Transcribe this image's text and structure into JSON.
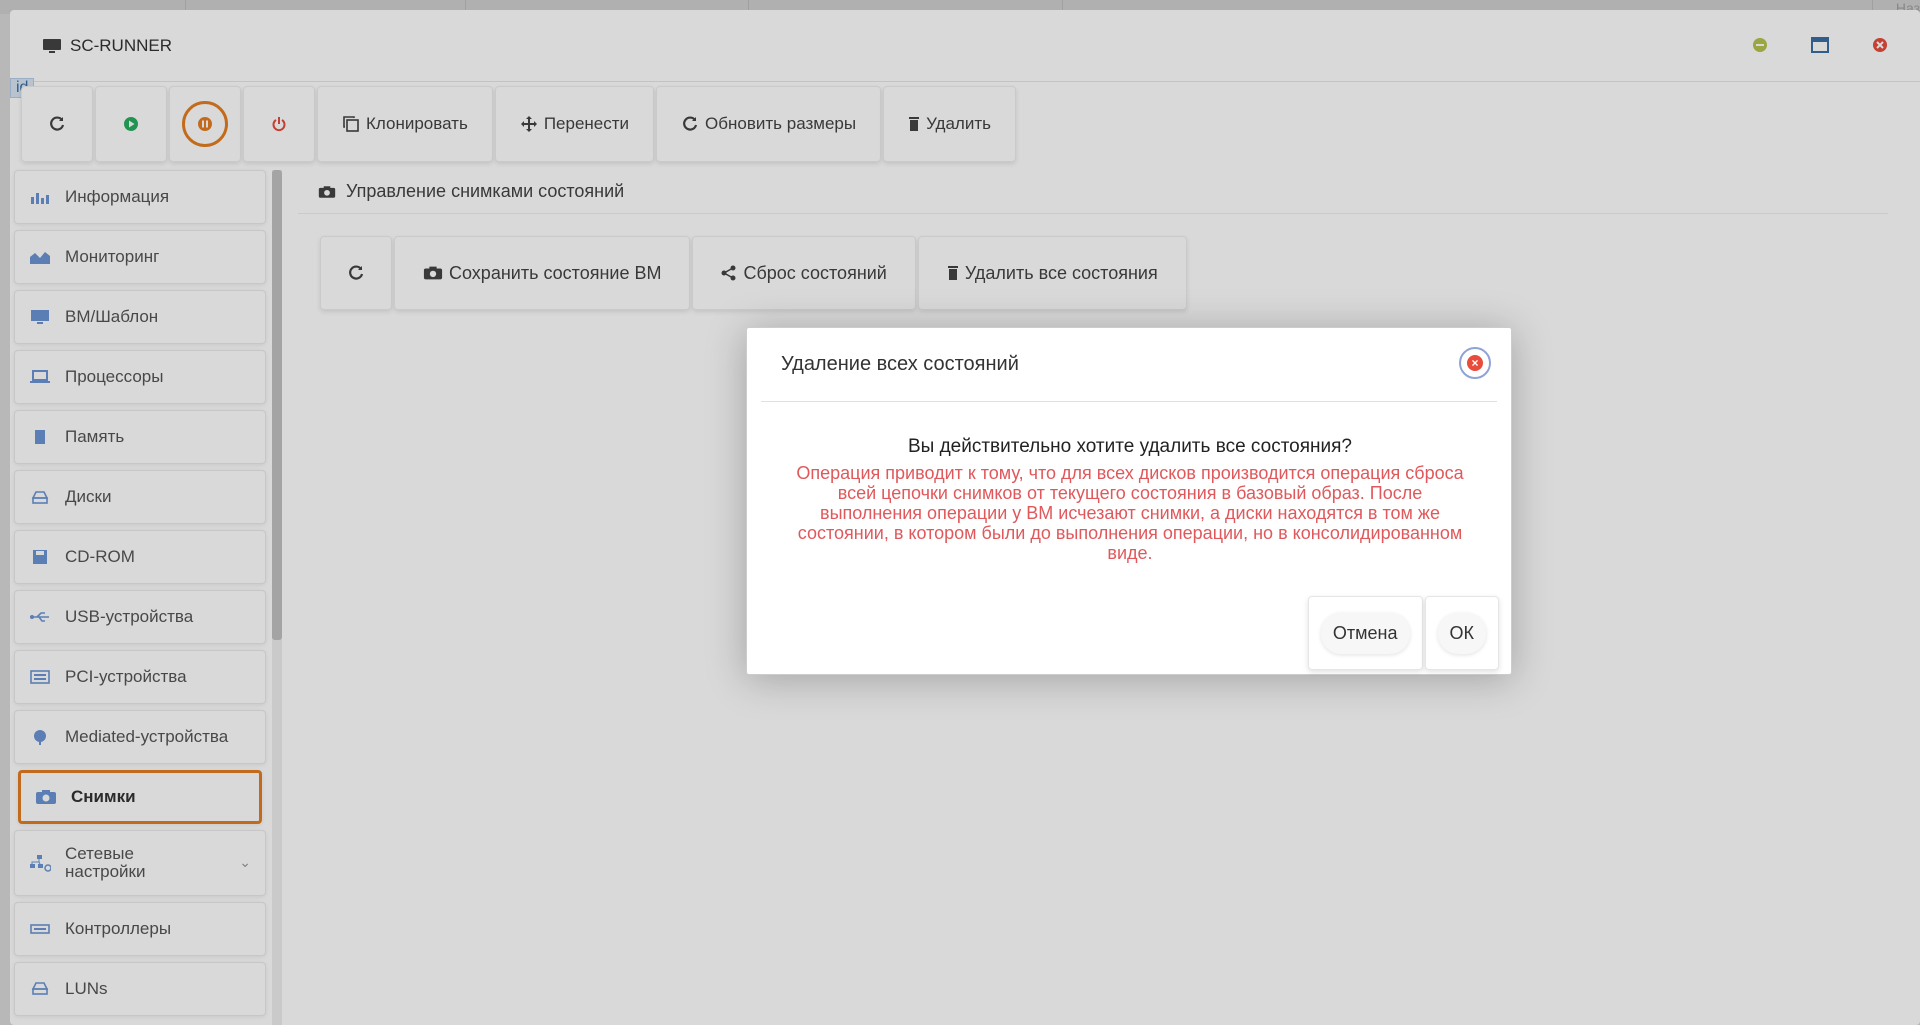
{
  "window": {
    "title": "SC-RUNNER",
    "id_badge": "id",
    "corner_text": "Наз"
  },
  "toolbar": {
    "refresh_icon": "refresh-icon",
    "start_icon": "play-icon",
    "pause_icon": "pause-icon",
    "power_icon": "power-icon",
    "clone_label": "Клонировать",
    "move_label": "Перенести",
    "resize_label": "Обновить размеры",
    "delete_label": "Удалить"
  },
  "sidebar": {
    "items": [
      {
        "label": "Информация",
        "icon": "bar-chart-icon"
      },
      {
        "label": "Мониторинг",
        "icon": "area-chart-icon"
      },
      {
        "label": "ВМ/Шаблон",
        "icon": "monitor-icon"
      },
      {
        "label": "Процессоры",
        "icon": "laptop-icon"
      },
      {
        "label": "Память",
        "icon": "memory-icon"
      },
      {
        "label": "Диски",
        "icon": "hdd-icon"
      },
      {
        "label": "CD-ROM",
        "icon": "save-icon"
      },
      {
        "label": "USB-устройства",
        "icon": "usb-icon"
      },
      {
        "label": "PCI-устройства",
        "icon": "pci-icon"
      },
      {
        "label": "Mediated-устройства",
        "icon": "mediated-icon"
      },
      {
        "label": "Снимки",
        "icon": "camera-icon"
      },
      {
        "label": "Сетевые настройки",
        "icon": "network-icon"
      },
      {
        "label": "Контроллеры",
        "icon": "controller-icon"
      },
      {
        "label": "LUNs",
        "icon": "lun-icon"
      }
    ]
  },
  "content": {
    "section_title": "Управление снимками состояний",
    "snap_toolbar": {
      "save_label": "Сохранить состояние ВМ",
      "reset_label": "Сброс состояний",
      "delete_all_label": "Удалить все состояния"
    }
  },
  "modal": {
    "title": "Удаление всех состояний",
    "question": "Вы действительно хотите удалить все состояния?",
    "warning": "Операция приводит к тому, что для всех дисков производится операция сброса всей цепочки снимков от текущего состояния в базовый образ. После выполнения операции у ВМ исчезают снимки, а диски находятся в том же состоянии, в котором были до выполнения операции, но в консолидированном виде.",
    "cancel_label": "Отмена",
    "ok_label": "ОК"
  },
  "colors": {
    "accent": "#e67e22",
    "warning_text": "#e0585b",
    "start_green": "#27ae60",
    "power_red": "#e74c3c",
    "sidebar_icon_blue": "#5b8bd0"
  }
}
